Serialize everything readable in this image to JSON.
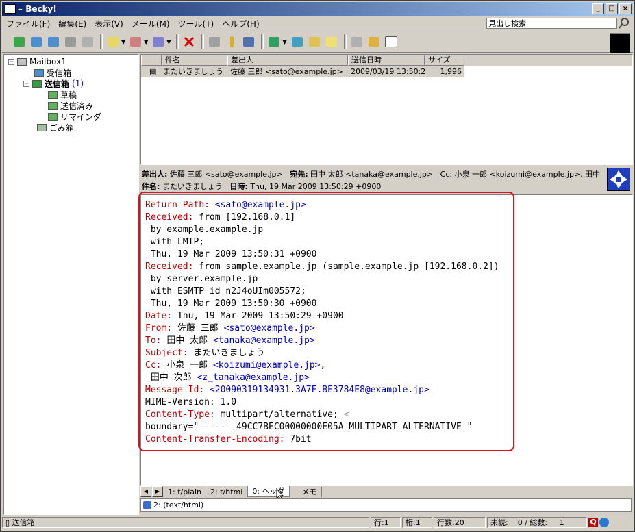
{
  "window": {
    "title": "Becky!",
    "minimize": "_",
    "maximize": "□",
    "close": "×"
  },
  "menu": [
    "ファイル(F)",
    "編集(E)",
    "表示(V)",
    "メール(M)",
    "ツール(T)",
    "ヘルプ(H)"
  ],
  "search": {
    "value": "見出し検索"
  },
  "tree": {
    "mailbox": "Mailbox1",
    "inbox": "受信箱",
    "outbox": "送信箱",
    "outbox_count": "(1)",
    "drafts": "草稿",
    "sent": "送信済み",
    "reminder": "リマインダ",
    "trash": "ごみ箱"
  },
  "list": {
    "headers": [
      "件名",
      "差出人",
      "送信日時",
      "サイズ"
    ],
    "rows": [
      {
        "subject": "またいきましょう",
        "from": "佐藤 三郎 <sato@example.jp>",
        "date": "2009/03/19 13:50:29",
        "size": "1,996"
      }
    ]
  },
  "header_pane": {
    "from_label": "差出人:",
    "from_value": "佐藤 三郎 <sato@example.jp>",
    "to_label": "宛先:",
    "to_value": "田中 太郎 <tanaka@example.jp>",
    "cc_value": "Cc: 小泉 一郎 <koizumi@example.jp>, 田中",
    "subject_label": "件名:",
    "subject_value": "またいきましょう",
    "date_label": "日時:",
    "date_value": "Thu, 19 Mar 2009 13:50:29 +0900"
  },
  "body": {
    "l1k": "Return-Path:",
    "l1u": "<sato@example.jp>",
    "l2k": "Received:",
    "l2v": "from [192.168.0.1]",
    "l3": " by example.example.jp",
    "l4": " with LMTP;",
    "l5": " Thu, 19 Mar 2009 13:50:31 +0900",
    "l6k": "Received:",
    "l6v": "from sample.example.jp (sample.example.jp [192.168.0.2])",
    "l7": " by server.example.jp",
    "l8": " with ESMTP id n2J4oUIm005572;",
    "l9": " Thu, 19 Mar 2009 13:50:30 +0900",
    "l10k": "Date:",
    "l10v": "Thu, 19 Mar 2009 13:50:29 +0900",
    "l11k": "From:",
    "l11v": "佐藤 三郎",
    "l11u": "<sato@example.jp>",
    "l12k": "To:",
    "l12v": "田中 太郎",
    "l12u": "<tanaka@example.jp>",
    "l13k": "Subject:",
    "l13v": "またいきましょう",
    "l14k": "Cc:",
    "l14v": "小泉 一郎",
    "l14u": "<koizumi@example.jp>",
    "l14t": ",",
    "l15v": " 田中 次郎",
    "l15u": "<z_tanaka@example.jp>",
    "l16k": "Message-Id:",
    "l16u": "<20090319134931.3A7F.BE3784E8@example.jp>",
    "l17": "MIME-Version: 1.0",
    "l18k": "Content-Type:",
    "l18v": "multipart/alternative;",
    "l18a": "<",
    "l19": "boundary=\"------_49CC7BEC00000000E05A_MULTIPART_ALTERNATIVE_\"",
    "l20k": "Content-Transfer-Encoding:",
    "l20v": "7bit"
  },
  "tabs": [
    "1: t/plain",
    "2: t/html",
    "0: ヘッダ",
    "メモ"
  ],
  "attachment": "2: (text/html)",
  "status": {
    "folder": "送信箱",
    "line": "行:1",
    "col": "桁:1",
    "lines": "行数:20",
    "unread": "未読:",
    "total": "0 / 総数:",
    "count": "1"
  },
  "colors": {
    "header_key": "#c00000",
    "address": "#0000c0",
    "highlight_box": "#e01020",
    "title_gradient_start": "#0a246a"
  }
}
